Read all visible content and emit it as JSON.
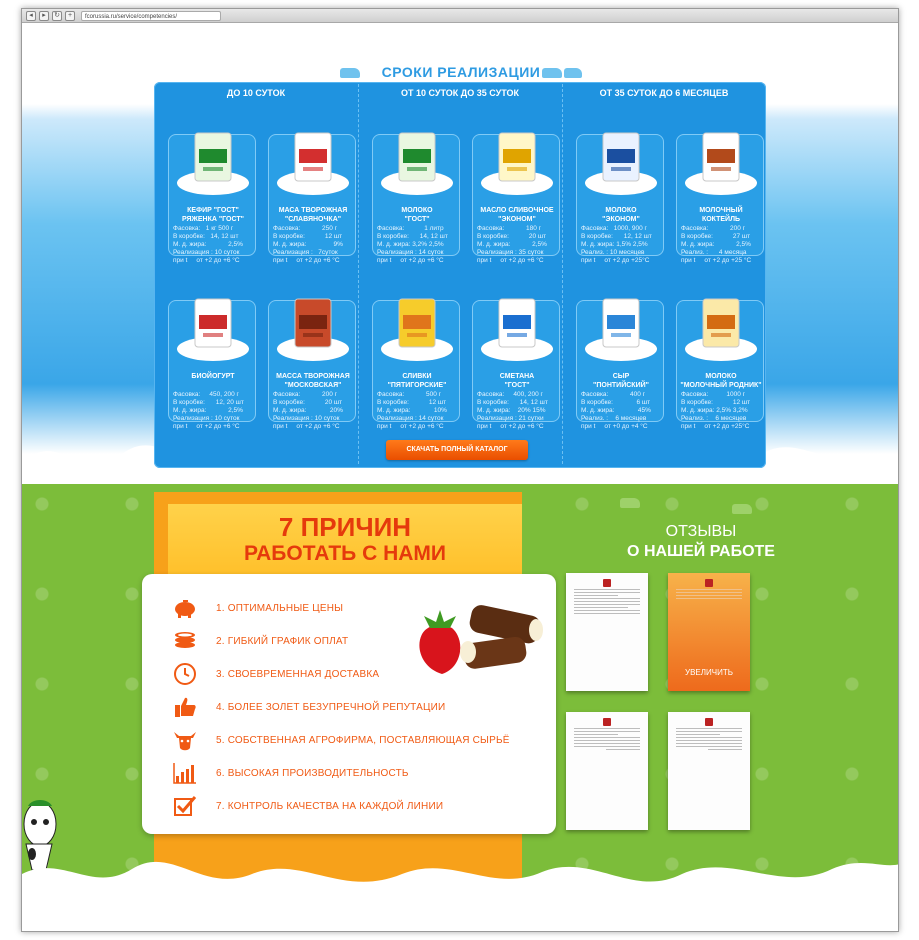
{
  "browser": {
    "back": "◂",
    "forward": "▸",
    "reload": "↻",
    "add": "+",
    "url": "fcorussia.ru/service/competencies/"
  },
  "shelf_life": {
    "title": "СРОКИ РЕАЛИЗАЦИИ",
    "columns": [
      "ДО 10 СУТОК",
      "ОТ 10 СУТОК ДО 35 СУТОК",
      "ОТ 35 СУТОК ДО 6 МЕСЯЦЕВ"
    ],
    "products": [
      {
        "name": "КЕФИР \"ГОСТ\"\nРЯЖЕНКА \"ГОСТ\"",
        "pack": "Фасовка:   1 кг 500 г",
        "box": "В коробке:   14, 12 шт",
        "fat": "М. д. жира:            2,5%",
        "term": "Реализация : 10 суток",
        "temp": "при t     от +2 до +6 °C"
      },
      {
        "name": "МАСА ТВОРОЖНАЯ\n\"СЛАВЯНОЧКА\"",
        "pack": "Фасовка:            250 г",
        "box": "В коробке:           12 шт",
        "fat": "М. д. жира:               9%",
        "term": "Реализация :   7суток",
        "temp": "при t     от +2 до +6 °C"
      },
      {
        "name": "МОЛОКО\n\"ГОСТ\"",
        "pack": "Фасовка:           1 литр",
        "box": "В коробке:      14, 12 шт",
        "fat": "М. д. жира: 3,2% 2,5%",
        "term": "Реализация : 14 суток",
        "temp": "при t     от +2 до +6 °C"
      },
      {
        "name": "МАСЛО СЛИВОЧНОЕ\n\"ЭКОНОМ\"",
        "pack": "Фасовка:            180 г",
        "box": "В коробке:           20 шт",
        "fat": "М. д. жира:            2,5%",
        "term": "Реализация : 35 суток",
        "temp": "при t     от +2 до +6 °C"
      },
      {
        "name": "МОЛОКО\n\"ЭКОНОМ\"",
        "pack": "Фасовка:   1000, 900 г",
        "box": "В коробке:      12, 12 шт",
        "fat": "М. д. жира: 1,5% 2,5%",
        "term": "Реализ. : 10 месяцев",
        "temp": "при t     от +2 до +25°C"
      },
      {
        "name": "МОЛОЧНЫЙ\nКОКТЕЙЛЬ",
        "pack": "Фасовка:            200 г",
        "box": "В коробке:           27 шт",
        "fat": "М. д. жира:            2,5%",
        "term": "Реализ. :      4 месяца",
        "temp": "при t     от +2 до +25 °C"
      },
      {
        "name": "БИОЙОГУРТ",
        "pack": "Фасовка:     450, 200 г",
        "box": "В коробке:      12, 20 шт",
        "fat": "М. д. жира:            2,5%",
        "term": "Реализация : 10 суток",
        "temp": "при t     от +2 до +6 °C"
      },
      {
        "name": "МАССА ТВОРОЖНАЯ\n\"МОСКОВСКАЯ\"",
        "pack": "Фасовка:            200 г",
        "box": "В коробке:           20 шт",
        "fat": "М. д. жира:             20%",
        "term": "Реализация : 10 суток",
        "temp": "при t     от +2 до +6 °C"
      },
      {
        "name": "СЛИВКИ\n\"ПЯТИГОРСКИЕ\"",
        "pack": "Фасовка:            500 г",
        "box": "В коробке:           12 шт",
        "fat": "М. д. жира:             10%",
        "term": "Реализация : 14 суток",
        "temp": "при t     от +2 до +6 °C"
      },
      {
        "name": "СМЕТАНА\n\"ГОСТ\"",
        "pack": "Фасовка:     400, 200 г",
        "box": "В коробке:      14, 12 шт",
        "fat": "М. д. жира:    20% 15%",
        "term": "Реализация : 21 сутки",
        "temp": "при t     от +2 до +6 °C"
      },
      {
        "name": "СЫР\n\"ПОНТИЙСКИЙ\"",
        "pack": "Фасовка:            400 г",
        "box": "В коробке:             6 шт",
        "fat": "М. д. жира:             45%",
        "term": "Реализ. :    6 месяцев",
        "temp": "при t     от +0 до +4 °C"
      },
      {
        "name": "МОЛОКО\n\"МОЛОЧНЫЙ РОДНИК\"",
        "pack": "Фасовка:          1000 г",
        "box": "В коробке:           12 шт",
        "fat": "М. д. жира: 2,5% 3,2%",
        "term": "Реализ. :    6 месяцев",
        "temp": "при t     от +2 до +25°C"
      }
    ],
    "download_button": "СКАЧАТЬ ПОЛНЫЙ КАТАЛОГ"
  },
  "reasons": {
    "title_line1": "7 ПРИЧИН",
    "title_line2": "РАБОТАТЬ С НАМИ",
    "items": [
      "1. ОПТИМАЛЬНЫЕ ЦЕНЫ",
      "2. ГИБКИЙ ГРАФИК ОПЛАТ",
      "3. СВОЕВРЕМЕННАЯ ДОСТАВКА",
      "4. БОЛЕЕ ЗОЛЕТ БЕЗУПРЕЧНОЙ РЕПУТАЦИИ",
      "5. СОБСТВЕННАЯ АГРОФИРМА, ПОСТАВЛЯЮЩАЯ СЫРЬЁ",
      "6. ВЫСОКАЯ ПРОИЗВОДИТЕЛЬНОСТЬ",
      "7. КОНТРОЛЬ КАЧЕСТВА НА КАЖДОЙ ЛИНИИ"
    ],
    "icons": [
      "piggy-bank-icon",
      "coins-icon",
      "clock-icon",
      "thumbs-up-icon",
      "cow-icon",
      "chart-icon",
      "checkbox-icon"
    ]
  },
  "reviews": {
    "title_line1": "ОТЗЫВЫ",
    "title_line2": "О НАШЕЙ РАБОТЕ",
    "zoom_label": "УВЕЛИЧИТЬ"
  },
  "colors": {
    "accent_orange": "#f05a14",
    "blue_board": "#1f93e0",
    "green_bg": "#7cbd3a",
    "title_blue": "#2e9be2"
  }
}
